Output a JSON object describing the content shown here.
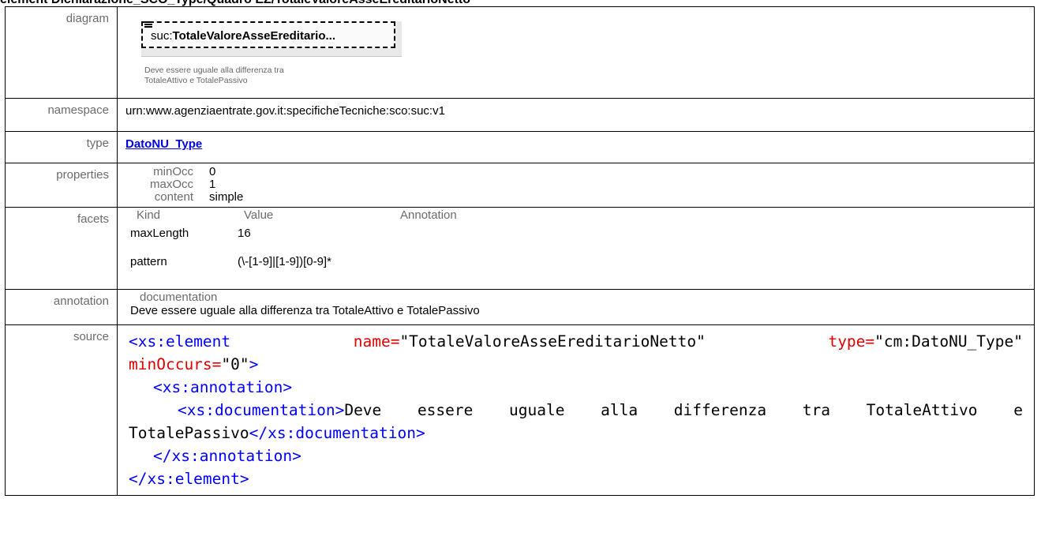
{
  "page_title": "element Dichiarazione_SCO_Type/Quadro EZ/TotaleValoreAsseEreditarioNetto",
  "rows": {
    "diagram": {
      "label": "diagram",
      "element_prefix": "suc:",
      "element_name": "TotaleValoreAsseEreditario...",
      "doc_line1": "Deve essere uguale alla differenza tra",
      "doc_line2": "TotaleAttivo e TotalePassivo"
    },
    "namespace": {
      "label": "namespace",
      "value": "urn:www.agenziaentrate.gov.it:specificheTecniche:sco:suc:v1"
    },
    "type": {
      "label": "type",
      "value": "DatoNU_Type"
    },
    "properties": {
      "label": "properties",
      "items": [
        {
          "key": "minOcc",
          "value": "0"
        },
        {
          "key": "maxOcc",
          "value": "1"
        },
        {
          "key": "content",
          "value": "simple"
        }
      ]
    },
    "facets": {
      "label": "facets",
      "headers": [
        "Kind",
        "Value",
        "Annotation"
      ],
      "items": [
        {
          "kind": "maxLength",
          "value": "16",
          "annotation": ""
        },
        {
          "kind": "pattern",
          "value": "(\\-[1-9]|[1-9])[0-9]*",
          "annotation": ""
        }
      ]
    },
    "annotation": {
      "label": "annotation",
      "header": "documentation",
      "text": "Deve essere uguale alla differenza tra TotaleAttivo e TotalePassivo"
    },
    "source": {
      "label": "source",
      "tag_element_open": "<xs:element",
      "attr_name": "name=",
      "val_name": "\"TotaleValoreAsseEreditarioNetto\"",
      "attr_type": "type=",
      "val_type": "\"cm:DatoNU_Type\"",
      "attr_minoccurs": "minOccurs=",
      "val_minoccurs": "\"0\"",
      "close_bracket": ">",
      "tag_annotation_open": "<xs:annotation>",
      "tag_documentation_open": "<xs:documentation>",
      "doc_words": [
        "Deve",
        "essere",
        "uguale",
        "alla",
        "differenza",
        "tra",
        "TotaleAttivo",
        "e"
      ],
      "doc_last": "TotalePassivo",
      "tag_documentation_close": "</xs:documentation>",
      "tag_annotation_close": "</xs:annotation>",
      "tag_element_close": "</xs:element>"
    }
  }
}
